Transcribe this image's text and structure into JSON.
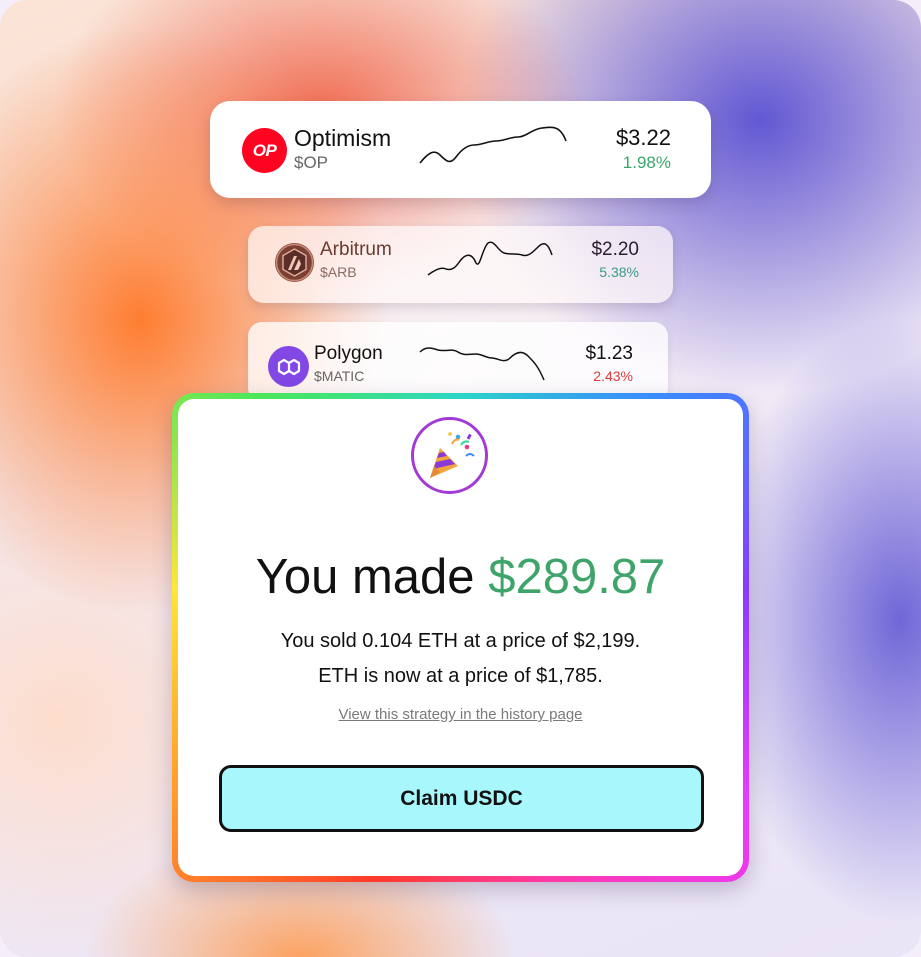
{
  "tokens": [
    {
      "name": "Optimism",
      "symbol": "$OP",
      "price": "$3.22",
      "change": "1.98%",
      "change_color": "#3aa66a",
      "logo_text": "OP",
      "logo_color": "#ff0420",
      "icon": "optimism-logo-icon"
    },
    {
      "name": "Arbitrum",
      "symbol": "$ARB",
      "price": "$2.20",
      "change": "5.38%",
      "change_color": "#3a9a88",
      "logo_color": "#8a4a3a",
      "icon": "arbitrum-logo-icon"
    },
    {
      "name": "Polygon",
      "symbol": "$MATIC",
      "price": "$1.23",
      "change": "2.43%",
      "change_color": "#e03a3a",
      "logo_color": "#8247e5",
      "icon": "polygon-logo-icon"
    }
  ],
  "modal": {
    "icon": "party-popper-icon",
    "headline_prefix": "You made ",
    "headline_amount": "$289.87",
    "amount_color": "#3ea46a",
    "line1": "You sold 0.104 ETH at a price of $2,199.",
    "line2": "ETH is now at a price of $1,785.",
    "history_link": "View this strategy in the history page",
    "claim_label": "Claim USDC",
    "claim_color": "#a8f7fd"
  }
}
